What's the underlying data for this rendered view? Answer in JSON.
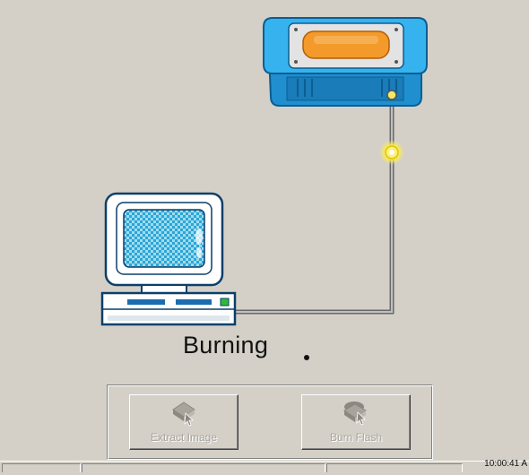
{
  "status": {
    "text": "Burning",
    "indicator": "."
  },
  "buttons": {
    "extract_label": "Extract Image",
    "burn_label": "Burn Flash",
    "extract_icon": "chip-extract-icon",
    "burn_icon": "chip-burn-icon"
  },
  "statusbar": {
    "time": "10:00:41 A"
  },
  "colors": {
    "window_bg": "#d4d0c8",
    "device_blue": "#2ea8e6",
    "device_orange": "#f39a2a",
    "screen_teal": "#48c2e0",
    "cable": "#8a8a8a",
    "spark": "#f7e43a"
  }
}
